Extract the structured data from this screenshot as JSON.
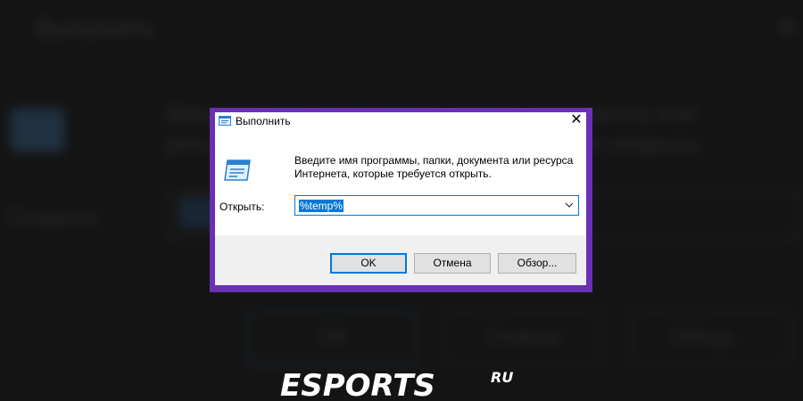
{
  "dialog": {
    "title": "Выполнить",
    "description": "Введите имя программы, папки, документа или ресурса Интернета, которые требуется открыть.",
    "open_label": "Открыть:",
    "combo_value": "%temp%",
    "buttons": {
      "ok": "OK",
      "cancel": "Отмена",
      "browse": "Обзор..."
    }
  },
  "watermark": {
    "text": "ESPORTS",
    "suffix": "RU"
  },
  "colors": {
    "frame": "#6b2fb3",
    "accent": "#0078d7",
    "background": "#141414",
    "footer": "#f0f0f0"
  },
  "icons": {
    "title": "run-icon",
    "main": "run-icon",
    "close": "close-icon",
    "dropdown": "chevron-down-icon"
  }
}
